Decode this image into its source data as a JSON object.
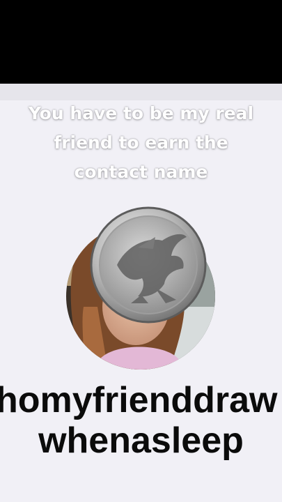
{
  "caption": {
    "line1": "You have to be my real",
    "line2": "friend to earn the",
    "line3": "contact name"
  },
  "contact": {
    "name_line1": "homyfrienddraw",
    "name_line2": "whenasleep"
  },
  "colors": {
    "background": "#f1f0f6",
    "caption_text": "#ffffff",
    "name_text": "#0b0b0b",
    "letterbox": "#000000"
  },
  "icons": {
    "coin": "silver-eagle-coin-icon"
  }
}
